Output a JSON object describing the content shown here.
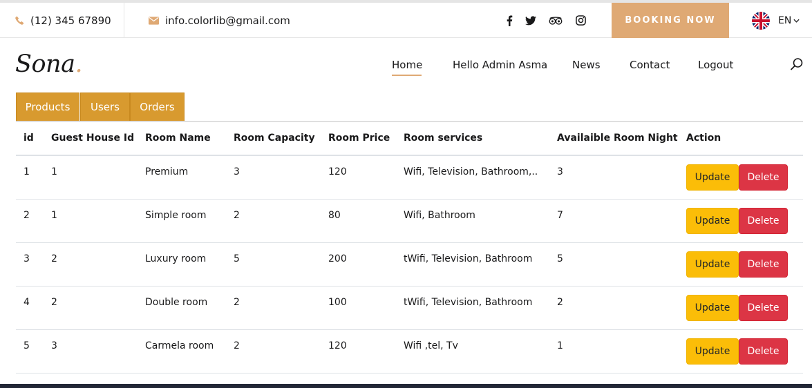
{
  "topbar": {
    "phone": "(12) 345 67890",
    "email": "info.colorlib@gmail.com",
    "social": [
      "facebook-icon",
      "twitter-icon",
      "tripadvisor-icon",
      "instagram-icon"
    ],
    "booking_label": "BOOKING NOW",
    "language": "EN"
  },
  "header": {
    "logo": "Sona",
    "logo_dot": ".",
    "nav": [
      "Home",
      "Hello Admin Asma",
      "News",
      "Contact",
      "Logout"
    ],
    "active_nav": "Home"
  },
  "tabs": [
    "Products",
    "Users",
    "Orders"
  ],
  "table": {
    "columns": [
      "id",
      "Guest House Id",
      "Room Name",
      "Room Capacity",
      "Room Price",
      "Room services",
      "Availaible Room Night",
      "Action"
    ],
    "rows": [
      [
        "1",
        "1",
        "Premium",
        "3",
        "120",
        "Wifi, Television, Bathroom,..",
        "3"
      ],
      [
        "2",
        "1",
        "Simple room",
        "2",
        "80",
        "Wifi, Bathroom",
        "7"
      ],
      [
        "3",
        "2",
        "Luxury room",
        "5",
        "200",
        "tWifi, Television, Bathroom",
        "5"
      ],
      [
        "4",
        "2",
        "Double room",
        "2",
        "100",
        "tWifi, Television, Bathroom",
        "2"
      ],
      [
        "5",
        "3",
        "Carmela room",
        "2",
        "120",
        "Wifi ,tel, Tv",
        "1"
      ]
    ],
    "update_label": "Update",
    "delete_label": "Delete"
  },
  "colors": {
    "accent": "#dfa974",
    "tab": "#d89a2f",
    "update": "#fbbd08",
    "delete": "#dc3545"
  }
}
